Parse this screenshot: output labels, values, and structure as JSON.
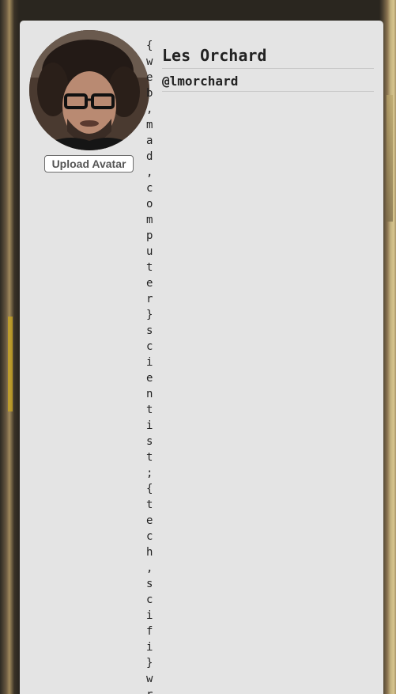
{
  "profile": {
    "name": "Les Orchard",
    "handle": "@lmorchard",
    "bio": "{web,mad,computer}scientist;{tech,scifi}wr",
    "upload_avatar_label": "Upload Avatar",
    "avatar_icon": "profile-photo"
  },
  "colors": {
    "card_background": "#e4e4e4",
    "text": "#222222",
    "divider": "#c8c8c8"
  }
}
